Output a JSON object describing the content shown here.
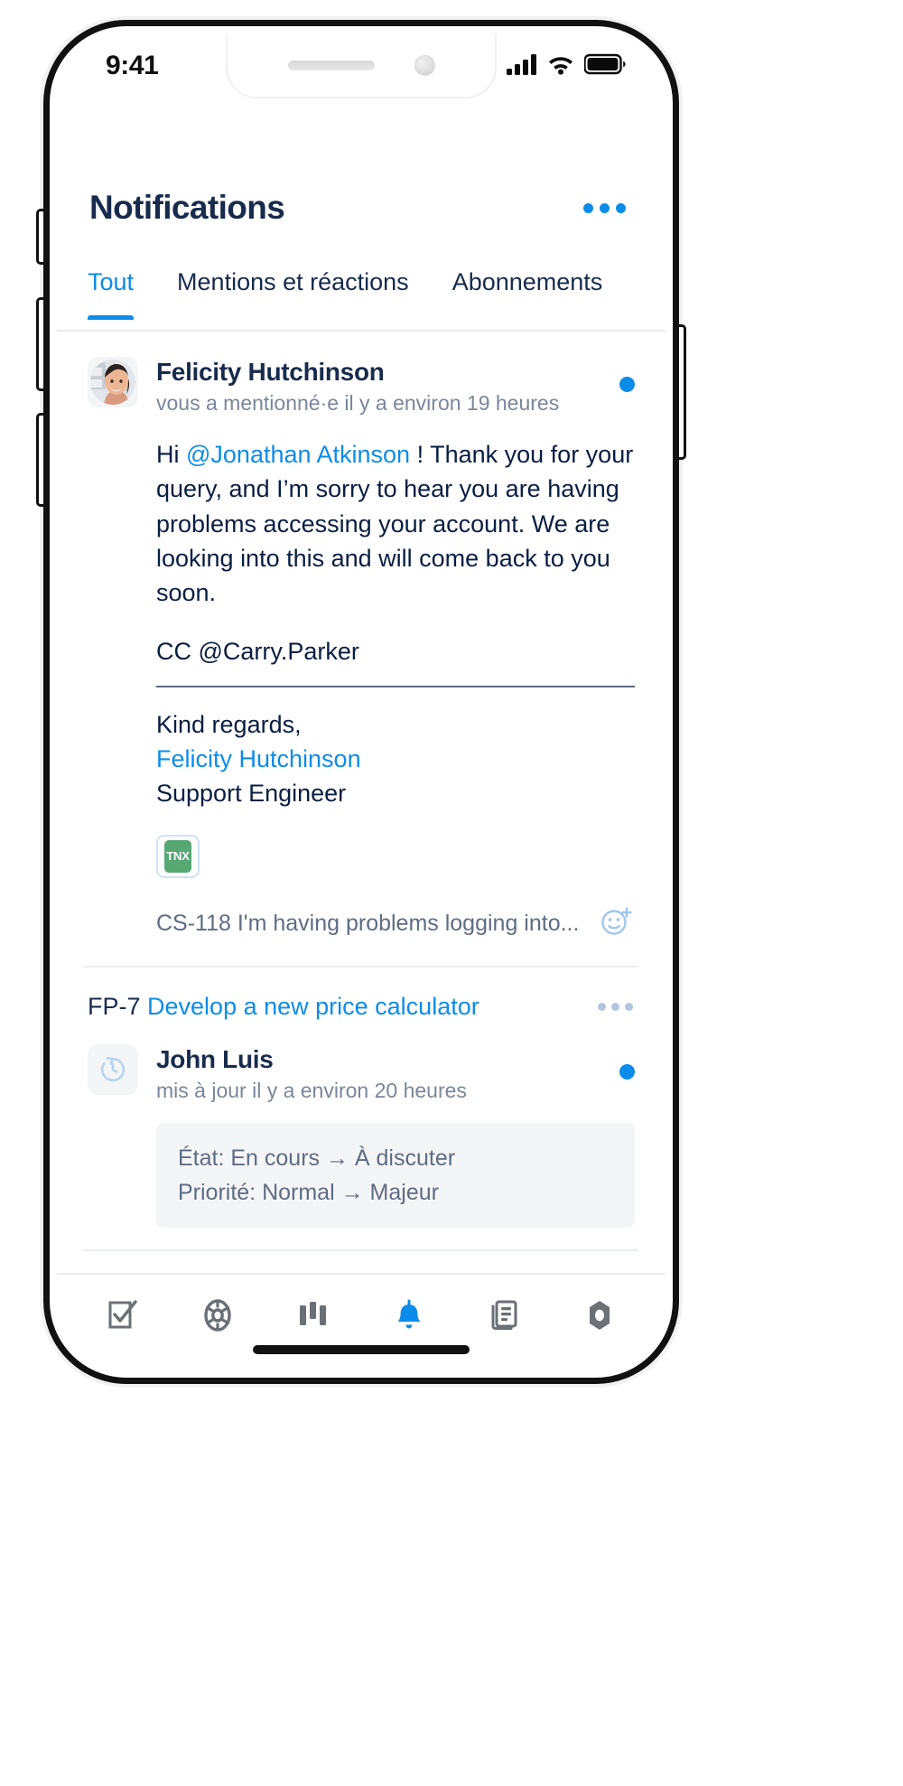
{
  "status_bar": {
    "time": "9:41",
    "icons": [
      "signal-icon",
      "wifi-icon",
      "battery-icon"
    ]
  },
  "header": {
    "title": "Notifications",
    "menu_icon": "more-horizontal-icon"
  },
  "tabs": [
    {
      "label": "Tout",
      "active": true
    },
    {
      "label": "Mentions et réactions",
      "active": false
    },
    {
      "label": "Abonnements",
      "active": false
    }
  ],
  "notifications": [
    {
      "avatar": "user-photo-avatar",
      "name": "Felicity Hutchinson",
      "subtitle": "vous a mentionné·e il y a environ 19 heures",
      "unread": true,
      "body_prefix": "Hi ",
      "body_mention": "@Jonathan Atkinson",
      "body_rest": " ! Thank you for your query, and I’m sorry to hear you are having problems accessing your account. We are looking into this and will come back to you soon.",
      "cc": "CC @Carry.Parker",
      "sign_off": "Kind regards,",
      "sign_name": "Felicity Hutchinson",
      "sign_role": "Support Engineer",
      "attachment_badge": "TNX",
      "footer_text": "CS-118 I'm having problems logging into...",
      "footer_icon": "add-reaction-icon"
    },
    {
      "issue_key": "FP-7",
      "issue_title": "Develop a new price calculator",
      "menu_icon": "more-horizontal-icon",
      "avatar": "update-circle-icon",
      "name": "John Luis",
      "subtitle": "mis à jour il y a environ 20 heures",
      "unread": true,
      "changes": [
        "État:  En cours → À discuter",
        "Priorité:  Normal → Majeur"
      ]
    }
  ],
  "bottom_nav": [
    {
      "icon": "tasks-checklist-icon",
      "active": false
    },
    {
      "icon": "lifebuoy-servicedesk-icon",
      "active": false
    },
    {
      "icon": "board-columns-icon",
      "active": false
    },
    {
      "icon": "bell-notifications-icon",
      "active": true
    },
    {
      "icon": "backlog-document-icon",
      "active": false
    },
    {
      "icon": "settings-nut-icon",
      "active": false
    }
  ],
  "colors": {
    "accent": "#0c8ce9",
    "text_primary": "#172b4d",
    "text_muted": "#7a869a",
    "badge_green": "#57a773"
  }
}
